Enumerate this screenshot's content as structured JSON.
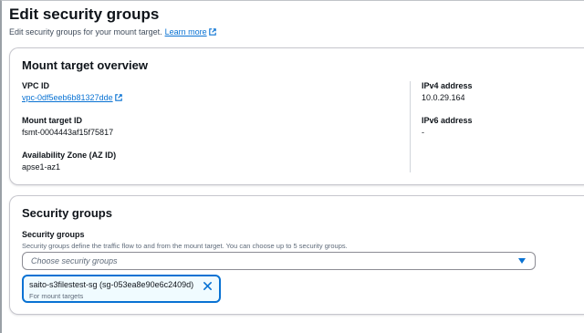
{
  "header": {
    "title": "Edit security groups",
    "description": "Edit security groups for your mount target.",
    "learn_more": "Learn more"
  },
  "overview": {
    "title": "Mount target overview",
    "vpc_id_label": "VPC ID",
    "vpc_id_value": "vpc-0df5eeb6b81327dde",
    "mount_target_id_label": "Mount target ID",
    "mount_target_id_value": "fsmt-0004443af15f75817",
    "az_label": "Availability Zone (AZ ID)",
    "az_value": "apse1-az1",
    "ipv4_label": "IPv4 address",
    "ipv4_value": "10.0.29.164",
    "ipv6_label": "IPv6 address",
    "ipv6_value": "-"
  },
  "security_groups": {
    "title": "Security groups",
    "field_label": "Security groups",
    "field_description": "Security groups define the traffic flow to and from the mount target. You can choose up to 5 security groups.",
    "select_placeholder": "Choose security groups",
    "tokens": [
      {
        "label": "saito-s3filestest-sg (sg-053ea8e90e6c2409d)",
        "description": "For mount targets"
      }
    ]
  },
  "colors": {
    "link": "#0972d3",
    "text": "#0f141a",
    "muted": "#5f6b7a",
    "token_bg": "#f0fbff"
  },
  "icons": {
    "external_link": "external-link-icon",
    "dropdown_caret": "caret-down-icon",
    "remove_token": "close-icon"
  }
}
